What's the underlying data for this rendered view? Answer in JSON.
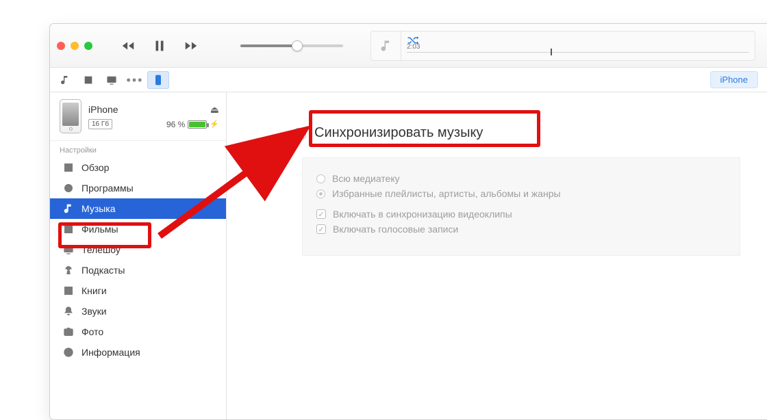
{
  "lcd": {
    "time": "2:03"
  },
  "tabrow": {
    "device_button": "iPhone"
  },
  "device": {
    "name": "iPhone",
    "capacity": "16 Гб",
    "battery_pct": "96 %"
  },
  "sidebar": {
    "section": "Настройки",
    "overview": "Обзор",
    "apps": "Программы",
    "music": "Музыка",
    "movies": "Фильмы",
    "tvshows": "Телешоу",
    "podcasts": "Подкасты",
    "books": "Книги",
    "tones": "Звуки",
    "photos": "Фото",
    "info": "Информация"
  },
  "content": {
    "sync_title": "Синхронизировать музыку",
    "opt_all": "Всю медиатеку",
    "opt_selected": "Избранные плейлисты, артисты, альбомы и жанры",
    "inc_videos": "Включать в синхронизацию видеоклипы",
    "inc_voice": "Включать голосовые записи"
  }
}
